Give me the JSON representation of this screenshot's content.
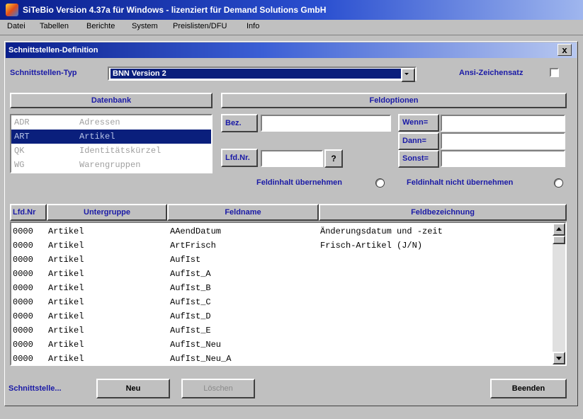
{
  "window": {
    "title": "SiTeBio Version 4.37a für Windows - lizenziert für Demand Solutions GmbH"
  },
  "menu": [
    "Datei",
    "Tabellen",
    "Berichte",
    "System",
    "Preislisten/DFU",
    "Info"
  ],
  "dialog": {
    "title": "Schnittstellen-Definition",
    "close_label": "x"
  },
  "interface_type": {
    "label": "Schnittstellen-Typ",
    "value": "BNN Version 2"
  },
  "ansi": {
    "label": "Ansi-Zeichensatz",
    "checked": false
  },
  "database": {
    "header": "Datenbank",
    "items": [
      {
        "code": "ADR",
        "name": "Adressen"
      },
      {
        "code": "ART",
        "name": "Artikel",
        "selected": true
      },
      {
        "code": "QK",
        "name": "Identitätskürzel"
      },
      {
        "code": "WG",
        "name": "Warengruppen"
      }
    ]
  },
  "field_options": {
    "header": "Feldoptionen",
    "bez_label": "Bez.",
    "bez_value": "",
    "lfdnr_label": "Lfd.Nr.",
    "lfdnr_value": "",
    "lookup_label": "?",
    "wenn_label": "Wenn=",
    "wenn_value": "",
    "dann_label": "Dann=",
    "dann_value": "",
    "sonst_label": "Sonst=",
    "sonst_value": "",
    "radio_take": "Feldinhalt übernehmen",
    "radio_not_take": "Feldinhalt nicht übernehmen"
  },
  "table": {
    "columns": [
      "Lfd.Nr",
      "Untergruppe",
      "Feldname",
      "Feldbezeichnung"
    ],
    "rows": [
      [
        "0000",
        "Artikel",
        "AAendDatum",
        "Änderungsdatum und -zeit"
      ],
      [
        "0000",
        "Artikel",
        "ArtFrisch",
        "Frisch-Artikel (J/N)"
      ],
      [
        "0000",
        "Artikel",
        "AufIst",
        ""
      ],
      [
        "0000",
        "Artikel",
        "AufIst_A",
        ""
      ],
      [
        "0000",
        "Artikel",
        "AufIst_B",
        ""
      ],
      [
        "0000",
        "Artikel",
        "AufIst_C",
        ""
      ],
      [
        "0000",
        "Artikel",
        "AufIst_D",
        ""
      ],
      [
        "0000",
        "Artikel",
        "AufIst_E",
        ""
      ],
      [
        "0000",
        "Artikel",
        "AufIst_Neu",
        ""
      ],
      [
        "0000",
        "Artikel",
        "AufIst_Neu_A",
        ""
      ]
    ]
  },
  "footer": {
    "interface_link": "Schnittstelle...",
    "new_button": "Neu",
    "delete_button": "Löschen",
    "exit_button": "Beenden"
  }
}
